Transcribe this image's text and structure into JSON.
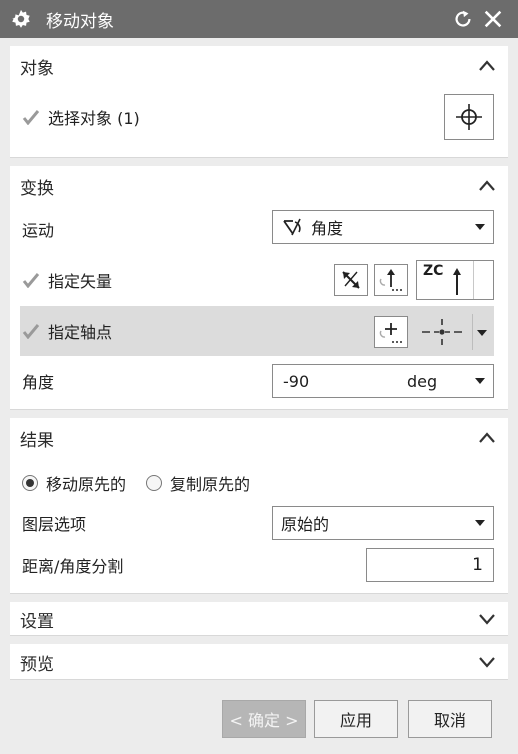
{
  "window": {
    "title": "移动对象",
    "icons": [
      "gear-icon",
      "reset-icon",
      "close-icon"
    ]
  },
  "sections": {
    "object": {
      "title": "对象",
      "select_label": "选择对象 (1)"
    },
    "transform": {
      "title": "变换",
      "motion_label": "运动",
      "motion_value": "角度",
      "vector_label": "指定矢量",
      "vector_axis": "ZC",
      "pivot_label": "指定轴点",
      "angle_label": "角度",
      "angle_value": "-90",
      "angle_unit": "deg"
    },
    "result": {
      "title": "结果",
      "radio_move": "移动原先的",
      "radio_copy": "复制原先的",
      "radio_selected": "移动原先的",
      "layer_label": "图层选项",
      "layer_value": "原始的",
      "split_label": "距离/角度分割",
      "split_value": "1"
    },
    "settings": {
      "title": "设置"
    },
    "preview": {
      "title": "预览"
    }
  },
  "buttons": {
    "ok": "< 确定 >",
    "apply": "应用",
    "cancel": "取消"
  }
}
